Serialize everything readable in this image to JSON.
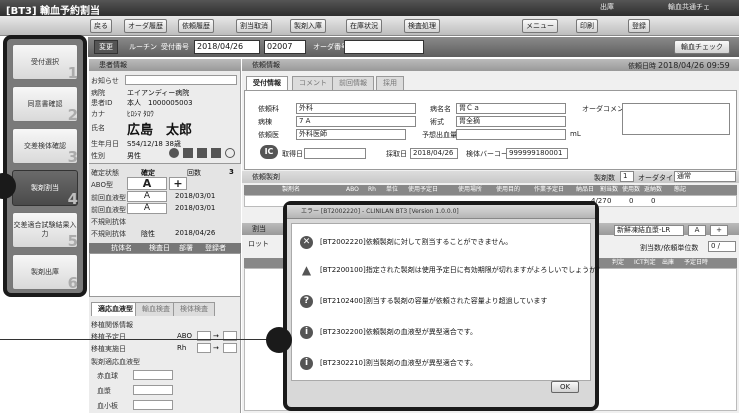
{
  "window": {
    "title": "[BT3] 輸血予約割当",
    "right_items": [
      "出庫",
      "輸血共通チェ"
    ]
  },
  "toolbar": {
    "items": [
      "戻る",
      "オーダ履歴",
      "依頼履歴",
      "割当取消",
      "製剤入庫",
      "在庫状況",
      "検査処理",
      "メニュー",
      "印刷",
      "登録"
    ]
  },
  "searchbar": {
    "change_label": "変更",
    "routine_label": "ルーチン",
    "date_label": "受付番号",
    "date_value": "2018/04/26",
    "number_value": "02007",
    "order_label": "オーダ番号",
    "check_button": "輸血チェック"
  },
  "left_menu": {
    "items": [
      {
        "label": "受付選択",
        "num": "1"
      },
      {
        "label": "同意書確認",
        "num": "2"
      },
      {
        "label": "交差検体確認",
        "num": "3"
      },
      {
        "label": "製剤割当",
        "num": "4"
      },
      {
        "label": "交差適合試験結果入力",
        "num": "5"
      },
      {
        "label": "製剤出庫",
        "num": "6"
      }
    ]
  },
  "patient": {
    "header": "患者情報",
    "rows": [
      {
        "label": "お知らせ",
        "value": ""
      },
      {
        "label": "病院",
        "value": "エイアンディー病院"
      },
      {
        "label": "患者ID",
        "value": "本人　1000005003"
      },
      {
        "label": "カナ",
        "value": "ﾋﾛｼﾏ ﾀﾛｳ"
      },
      {
        "label": "氏名",
        "value": "広島　太郎"
      },
      {
        "label": "生年月日",
        "value": "S54/12/18  38歳"
      },
      {
        "label": "性別",
        "value": "男性"
      }
    ],
    "blood": {
      "status_label": "確定状態",
      "status_value": "確定",
      "count_label": "回数",
      "count_value": "3",
      "abo_label": "ABO型",
      "abo_value": "A",
      "plus": "+",
      "row2_label": "前回血液型",
      "row2_value": "A",
      "row2_date": "2018/03/01",
      "row3_label": "前回血液型",
      "row3_value": "A",
      "row3_date": "2018/03/01",
      "row4_label": "不規則抗体",
      "row5_label": "不規則抗体",
      "row5_value": "陰性",
      "row5_date": "2018/04/26"
    },
    "antibody_cols": [
      "抗体名",
      "検査日",
      "部署",
      "登録者"
    ],
    "tabs": [
      "適応血液型",
      "輸血検査",
      "検体検査"
    ],
    "section1": "移植関係情報",
    "transplant_rows": [
      {
        "label": "移植予定日",
        "abo": "ABO",
        "arrow": "→"
      },
      {
        "label": "移植実施日",
        "abo": "Rh",
        "arrow": "→"
      }
    ],
    "section2": "製剤適応血液型",
    "product_rows": [
      "赤血球",
      "血漿",
      "血小板"
    ]
  },
  "order": {
    "header": "依頼情報",
    "request_date_label": "依頼日時",
    "request_date_value": "2018/04/26 09:59",
    "tabs": [
      "受付情報",
      "コメント",
      "前回情報",
      "採用"
    ],
    "dept_label": "依頼科",
    "dept_value": "外科",
    "ward_label": "病棟",
    "ward_value": "7 A",
    "doctor_label": "依頼医",
    "doctor_value": "外科医師",
    "disease_label": "病名名",
    "disease_value": "胃Ｃａ",
    "surgery_label": "術式",
    "surgery_value": "胃全摘",
    "bleed_label": "予想出血量",
    "bleed_unit": "mL",
    "order_comment_label": "オーダコメント",
    "ic_label": "IC",
    "ic_sub": "取得日",
    "collect_label": "採取日",
    "collect_date": "2018/04/26",
    "barcode_label": "検体バーコード",
    "barcode_value": "999999180001",
    "products_header": "依頼製剤",
    "product_count_label": "製剤数",
    "product_count_value": "1",
    "order_type_label": "オーダタイプ",
    "order_type_value": "通常",
    "product_cols": [
      "製剤名",
      "ABO",
      "Rh",
      "単位",
      "使用予定日",
      "使用場所",
      "使用目的",
      "作業予定日",
      "納品日",
      "割当数",
      "使用数",
      "返納数",
      "態記"
    ],
    "row_date": "4/27",
    "row_nums": [
      "0",
      "0",
      "0"
    ],
    "assign_label": "割当",
    "lot_label": "ロット",
    "product_select": "新鮮凍結血漿-LR",
    "product_abo": "A",
    "product_plus": "+",
    "assign_count_label": "割当数/依頼単位数",
    "assign_count_value": "0 /",
    "assign_cols": [
      "判定",
      "ICT判定",
      "出庫",
      "予定日時"
    ]
  },
  "dialog": {
    "title": "エラー [BT2002220] - CLINILAN BT3 [Version 1.0.0.0]",
    "messages": [
      {
        "icon": "error",
        "text": "[BT2002220]依頼製剤に対して割当することができません。"
      },
      {
        "icon": "warning",
        "text": "[BT2200100]指定された製剤は使用予定日に有効期限が切れますがよろしいでしょうか？"
      },
      {
        "icon": "question",
        "text": "[BT2102400]割当する製剤の容量が依頼された容量より超過しています"
      },
      {
        "icon": "info",
        "text": "[BT2302200]依頼製剤の血液型が異型適合です。"
      },
      {
        "icon": "info",
        "text": "[BT2302210]割当製剤の血液型が異型適合です。"
      }
    ],
    "ok": "OK"
  }
}
